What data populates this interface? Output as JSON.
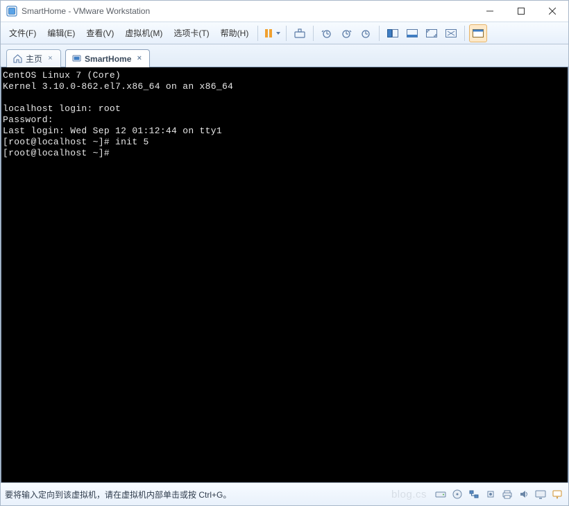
{
  "window": {
    "title": "SmartHome - VMware Workstation"
  },
  "menu": {
    "file": "文件(F)",
    "edit": "编辑(E)",
    "view": "查看(V)",
    "vm": "虚拟机(M)",
    "tabs": "选项卡(T)",
    "help": "帮助(H)"
  },
  "tabs": {
    "home": "主页",
    "vm": "SmartHome"
  },
  "console": {
    "lines": [
      "CentOS Linux 7 (Core)",
      "Kernel 3.10.0-862.el7.x86_64 on an x86_64",
      "",
      "localhost login: root",
      "Password:",
      "Last login: Wed Sep 12 01:12:44 on tty1",
      "[root@localhost ~]# init 5",
      "[root@localhost ~]# "
    ]
  },
  "status": {
    "text": "要将输入定向到该虚拟机，请在虚拟机内部单击或按 Ctrl+G。",
    "watermark": "blog.cs"
  },
  "icons": {
    "pause": "pause-icon",
    "snapshot": "camera-icon",
    "clock": "clock-icon",
    "views": "view-icons"
  }
}
